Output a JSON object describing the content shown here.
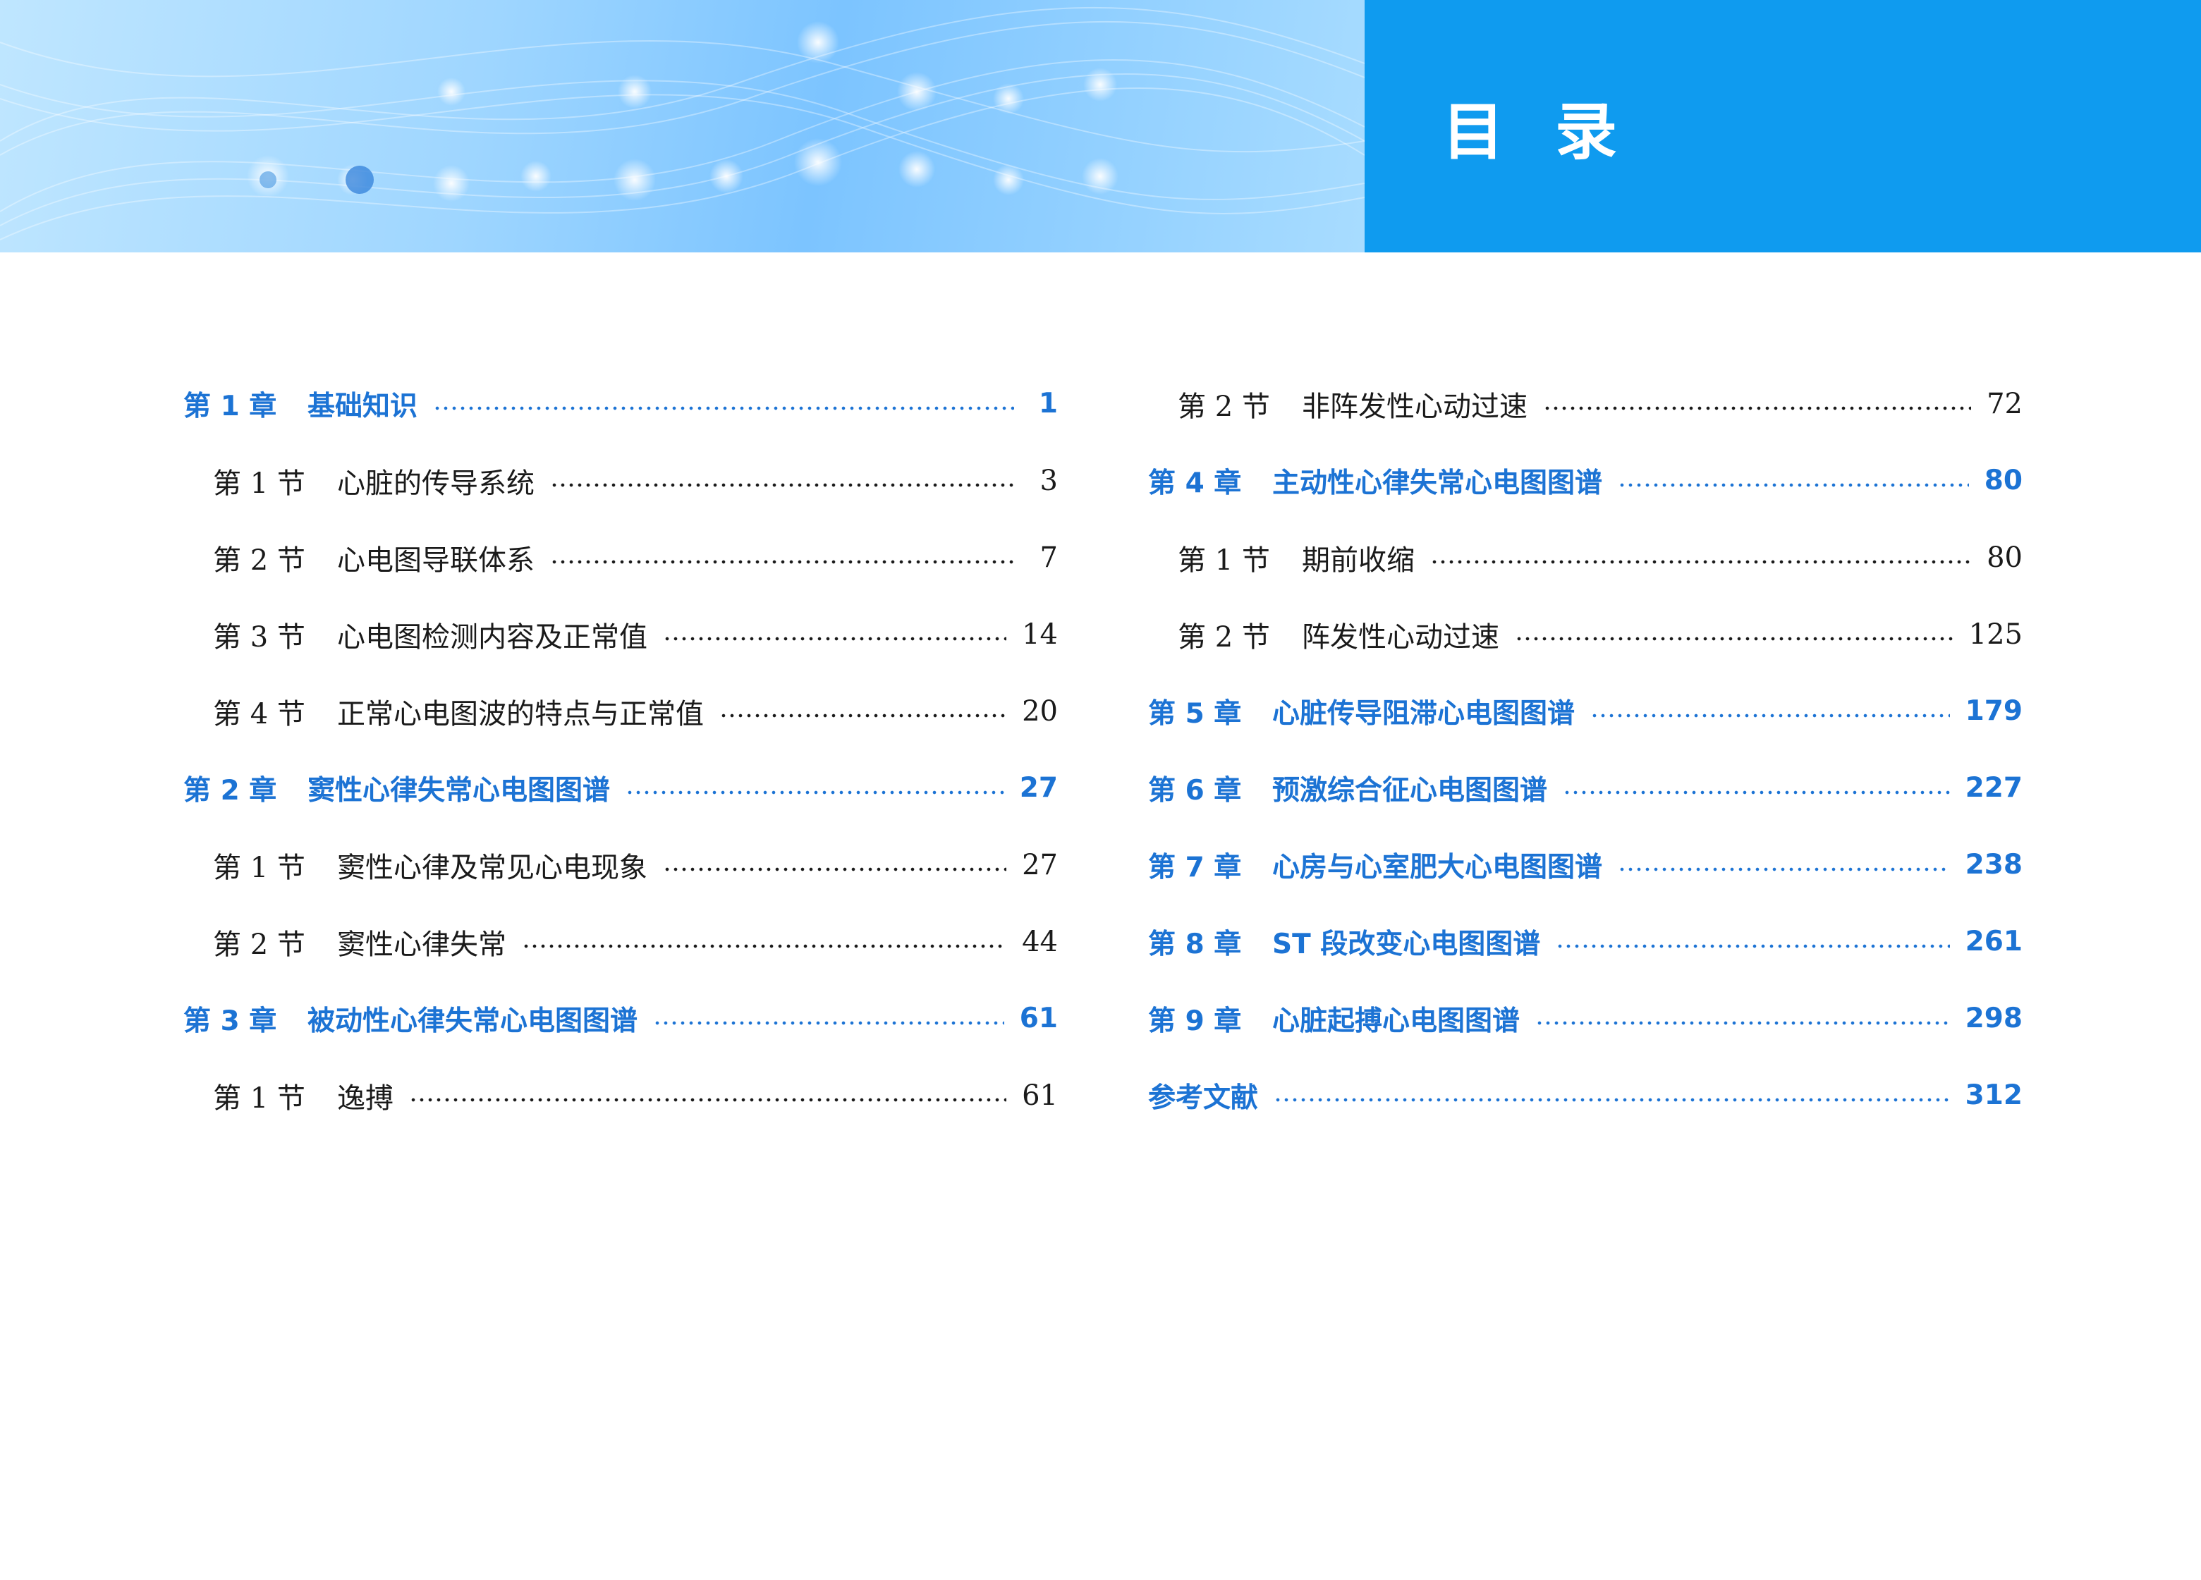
{
  "header": {
    "title": "目录"
  },
  "toc_left": [
    {
      "kind": "chapter",
      "num": "第 1 章",
      "label": "基础知识",
      "page": "1"
    },
    {
      "kind": "section",
      "num": "第 1 节",
      "label": "心脏的传导系统",
      "page": "3"
    },
    {
      "kind": "section",
      "num": "第 2 节",
      "label": "心电图导联体系",
      "page": "7"
    },
    {
      "kind": "section",
      "num": "第 3 节",
      "label": "心电图检测内容及正常值",
      "page": "14"
    },
    {
      "kind": "section",
      "num": "第 4 节",
      "label": "正常心电图波的特点与正常值",
      "page": "20"
    },
    {
      "kind": "chapter",
      "num": "第 2 章",
      "label": "窦性心律失常心电图图谱",
      "page": "27"
    },
    {
      "kind": "section",
      "num": "第 1 节",
      "label": "窦性心律及常见心电现象",
      "page": "27"
    },
    {
      "kind": "section",
      "num": "第 2 节",
      "label": "窦性心律失常",
      "page": "44"
    },
    {
      "kind": "chapter",
      "num": "第 3 章",
      "label": "被动性心律失常心电图图谱",
      "page": "61"
    },
    {
      "kind": "section",
      "num": "第 1 节",
      "label": "逸搏",
      "page": "61"
    }
  ],
  "toc_right": [
    {
      "kind": "section",
      "num": "第 2 节",
      "label": "非阵发性心动过速",
      "page": "72"
    },
    {
      "kind": "chapter",
      "num": "第 4 章",
      "label": "主动性心律失常心电图图谱",
      "page": "80"
    },
    {
      "kind": "section",
      "num": "第 1 节",
      "label": "期前收缩",
      "page": "80"
    },
    {
      "kind": "section",
      "num": "第 2 节",
      "label": "阵发性心动过速",
      "page": "125"
    },
    {
      "kind": "chapter",
      "num": "第 5 章",
      "label": "心脏传导阻滞心电图图谱",
      "page": "179"
    },
    {
      "kind": "chapter",
      "num": "第 6 章",
      "label": "预激综合征心电图图谱",
      "page": "227"
    },
    {
      "kind": "chapter",
      "num": "第 7 章",
      "label": "心房与心室肥大心电图图谱",
      "page": "238"
    },
    {
      "kind": "chapter",
      "num": "第 8 章",
      "label": "ST 段改变心电图图谱",
      "page": "261"
    },
    {
      "kind": "chapter",
      "num": "第 9 章",
      "label": "心脏起搏心电图图谱",
      "page": "298"
    },
    {
      "kind": "ref",
      "num": "",
      "label": "参考文献",
      "page": "312"
    }
  ],
  "colors": {
    "chapter_text": "#1c73d4",
    "section_text": "#1a1a1a",
    "title_block": "#0f9bef"
  }
}
